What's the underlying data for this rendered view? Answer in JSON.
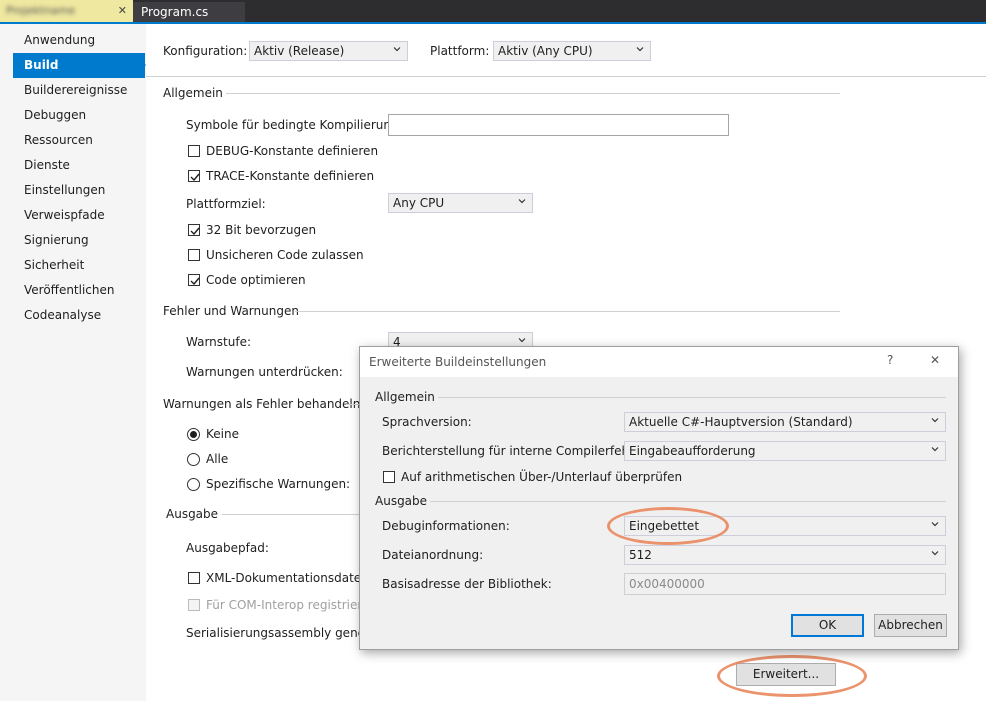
{
  "tabs": {
    "blurred_tab": "Projektname",
    "active_tab": "Program.cs"
  },
  "sidebar": {
    "items": [
      {
        "label": "Anwendung"
      },
      {
        "label": "Build"
      },
      {
        "label": "Builderereignisse"
      },
      {
        "label": "Debuggen"
      },
      {
        "label": "Ressourcen"
      },
      {
        "label": "Dienste"
      },
      {
        "label": "Einstellungen"
      },
      {
        "label": "Verweispfade"
      },
      {
        "label": "Signierung"
      },
      {
        "label": "Sicherheit"
      },
      {
        "label": "Veröffentlichen"
      },
      {
        "label": "Codeanalyse"
      }
    ],
    "selected": "Build"
  },
  "header": {
    "config_label": "Konfiguration:",
    "config_value": "Aktiv (Release)",
    "platform_label": "Plattform:",
    "platform_value": "Aktiv (Any CPU)"
  },
  "general": {
    "title": "Allgemein",
    "symbols_label": "Symbole für bedingte Kompilierung:",
    "symbols_value": "",
    "debug_label": "DEBUG-Konstante definieren",
    "debug_checked": false,
    "trace_label": "TRACE-Konstante definieren",
    "trace_checked": true,
    "target_label": "Plattformziel:",
    "target_value": "Any CPU",
    "prefer32_label": "32 Bit bevorzugen",
    "prefer32_checked": true,
    "unsafe_label": "Unsicheren Code zulassen",
    "unsafe_checked": false,
    "optimize_label": "Code optimieren",
    "optimize_checked": true
  },
  "errors": {
    "title": "Fehler und Warnungen",
    "warnlevel_label": "Warnstufe:",
    "warnlevel_value": "4",
    "suppress_label": "Warnungen unterdrücken:"
  },
  "treat_warnings": {
    "title": "Warnungen als Fehler behandeln",
    "options": [
      {
        "label": "Keine",
        "selected": true
      },
      {
        "label": "Alle",
        "selected": false
      },
      {
        "label": "Spezifische Warnungen:",
        "selected": false
      }
    ]
  },
  "output": {
    "title": "Ausgabe",
    "path_label": "Ausgabepfad:",
    "xml_label": "XML-Dokumentationsdatei:",
    "xml_checked": false,
    "com_label": "Für COM-Interop registrieren",
    "com_checked": false,
    "serial_label": "Serialisierungsassembly generieren",
    "advanced_button": "Erweitert..."
  },
  "dialog": {
    "title": "Erweiterte Buildeinstellungen",
    "help": "?",
    "close": "✕",
    "general_title": "Allgemein",
    "langver_label": "Sprachversion:",
    "langver_value": "Aktuelle C#-Hauptversion (Standard)",
    "report_label": "Berichterstellung für interne Compilerfehler:",
    "report_value": "Eingabeaufforderung",
    "overflow_label": "Auf arithmetischen Über-/Unterlauf überprüfen",
    "overflow_checked": false,
    "output_title": "Ausgabe",
    "debuginfo_label": "Debuginformationen:",
    "debuginfo_value": "Eingebettet",
    "filealign_label": "Dateianordnung:",
    "filealign_value": "512",
    "baseaddr_label": "Basisadresse der Bibliothek:",
    "baseaddr_value": "0x00400000",
    "ok": "OK",
    "cancel": "Abbrechen"
  },
  "colors": {
    "accent": "#007acc",
    "highlight": "#e9875d"
  }
}
